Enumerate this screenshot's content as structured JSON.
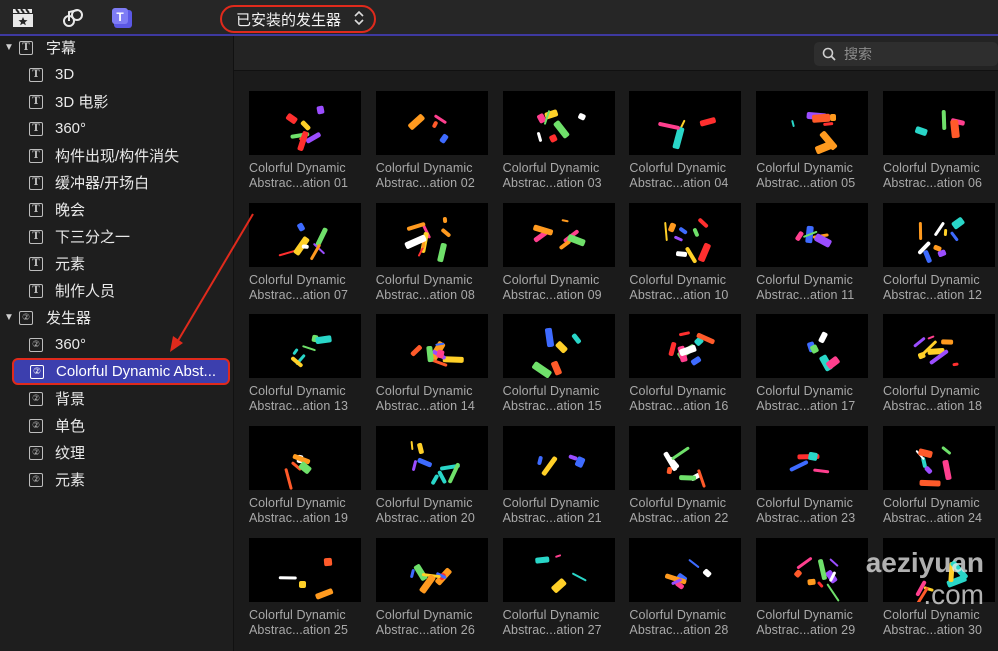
{
  "toolbar": {
    "icons": [
      "clapper-icon",
      "music-icon",
      "titles-icon"
    ],
    "popup_label": "已安装的发生器",
    "popup_chevron": "⌃⌄"
  },
  "search": {
    "placeholder": "搜索"
  },
  "sidebar": {
    "groups": [
      {
        "label": "字幕",
        "items": [
          "3D",
          "3D 电影",
          "360°",
          "构件出现/构件消失",
          "缓冲器/开场白",
          "晚会",
          "下三分之一",
          "元素",
          "制作人员"
        ]
      },
      {
        "label": "发生器",
        "items": [
          "360°",
          "Colorful Dynamic Abst...",
          "背景",
          "单色",
          "纹理",
          "元素"
        ]
      }
    ],
    "selected": "Colorful Dynamic Abst..."
  },
  "grid": {
    "line1": "Colorful Dynamic",
    "items": [
      "Abstrac...ation 01",
      "Abstrac...ation 02",
      "Abstrac...ation 03",
      "Abstrac...ation 04",
      "Abstrac...ation 05",
      "Abstrac...ation 06",
      "Abstrac...ation 07",
      "Abstrac...ation 08",
      "Abstrac...ation 09",
      "Abstrac...ation 10",
      "Abstrac...ation 11",
      "Abstrac...ation 12",
      "Abstrac...ation 13",
      "Abstrac...ation 14",
      "Abstrac...ation 15",
      "Abstrac...ation 16",
      "Abstrac...ation 17",
      "Abstrac...ation 18",
      "Abstrac...ation 19",
      "Abstrac...ation 20",
      "Abstrac...ation 21",
      "Abstrac...ation 22",
      "Abstrac...ation 23",
      "Abstrac...ation 24",
      "Abstrac...ation 25",
      "Abstrac...ation 26",
      "Abstrac...ation 27",
      "Abstrac...ation 28",
      "Abstrac...ation 29",
      "Abstrac...ation 30"
    ]
  },
  "watermark": {
    "line1": "aeziyuan",
    "line2": ".com"
  },
  "colors": {
    "accent": "#3c3fae",
    "highlight": "#e02a1c"
  }
}
